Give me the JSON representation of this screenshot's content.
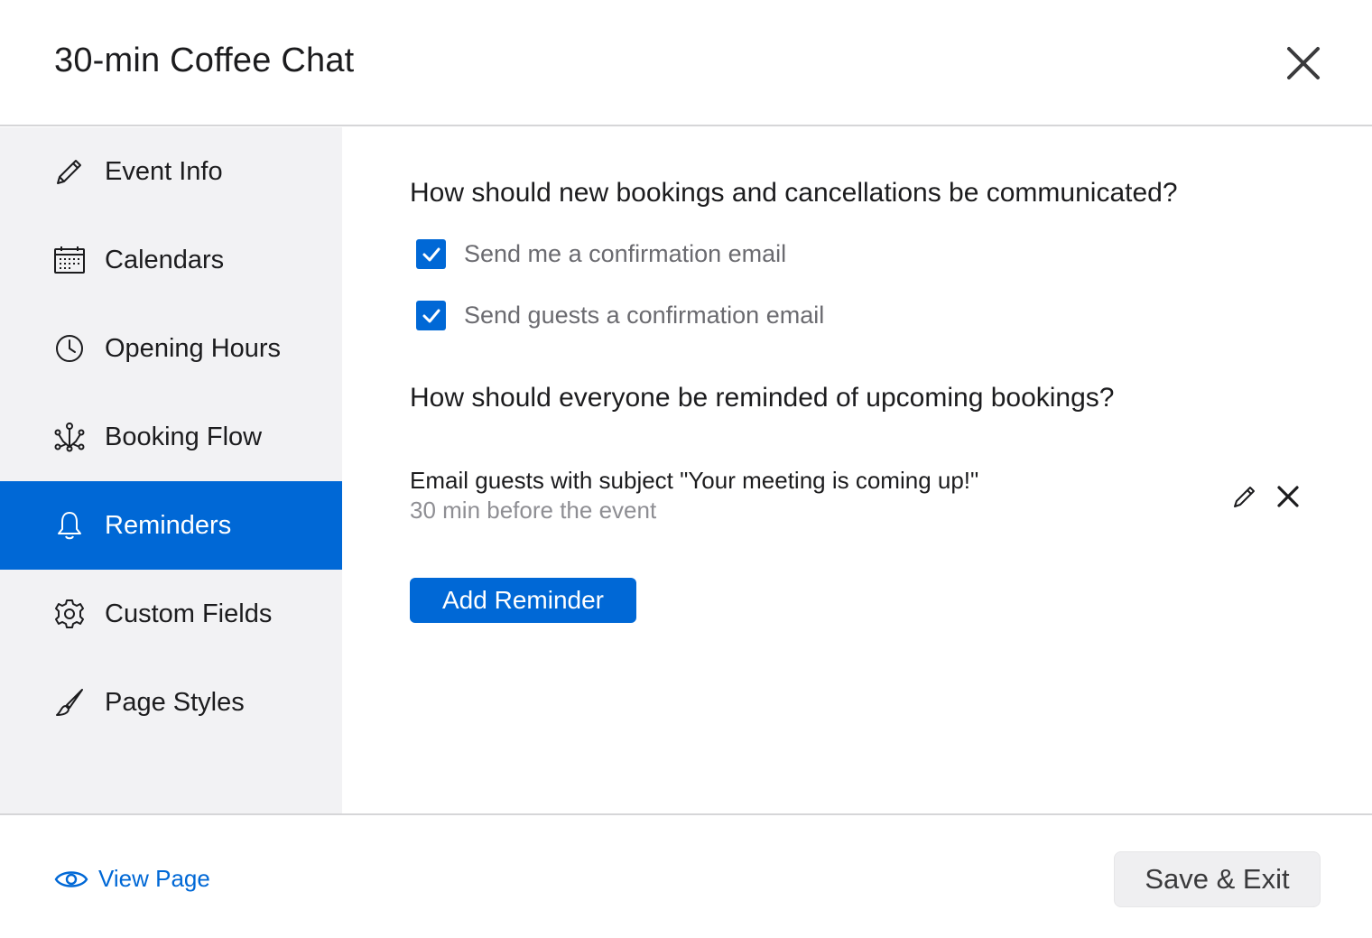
{
  "header": {
    "title": "30-min Coffee Chat",
    "close_icon": "close-icon"
  },
  "sidebar": {
    "active_color": "#0068d6",
    "items": [
      {
        "label": "Event Info",
        "icon": "pencil-icon",
        "active": false
      },
      {
        "label": "Calendars",
        "icon": "calendar-icon",
        "active": false
      },
      {
        "label": "Opening Hours",
        "icon": "clock-icon",
        "active": false
      },
      {
        "label": "Booking Flow",
        "icon": "flow-icon",
        "active": false
      },
      {
        "label": "Reminders",
        "icon": "bell-icon",
        "active": true
      },
      {
        "label": "Custom Fields",
        "icon": "gear-icon",
        "active": false
      },
      {
        "label": "Page Styles",
        "icon": "brush-icon",
        "active": false
      }
    ]
  },
  "main": {
    "communication_question": "How should new bookings and cancellations be communicated?",
    "options": [
      {
        "label": "Send me a confirmation email",
        "checked": true
      },
      {
        "label": "Send guests a confirmation email",
        "checked": true
      }
    ],
    "reminder_question": "How should everyone be reminded of upcoming bookings?",
    "reminders": [
      {
        "title": "Email guests with subject \"Your meeting is coming up!\"",
        "timing": "30 min before the event"
      }
    ],
    "add_reminder_label": "Add Reminder"
  },
  "footer": {
    "view_page_label": "View Page",
    "save_label": "Save & Exit"
  }
}
